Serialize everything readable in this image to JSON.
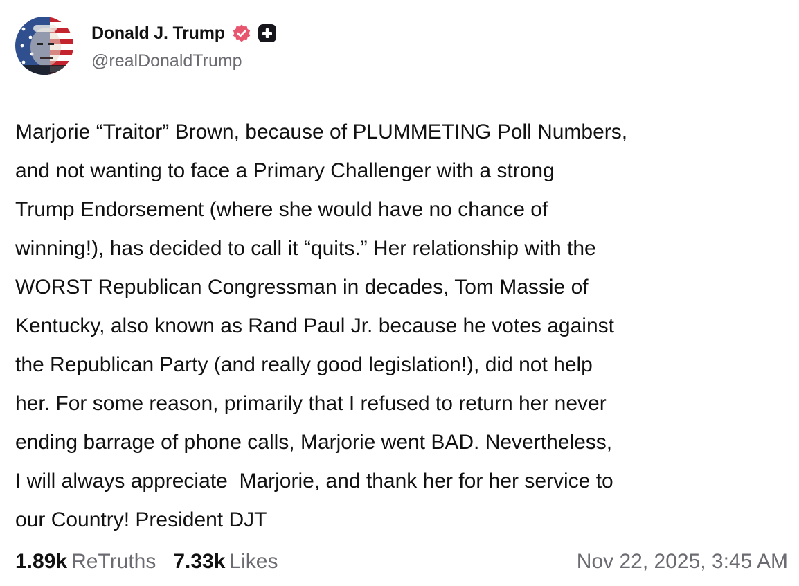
{
  "author": {
    "display_name": "Donald J. Trump",
    "handle": "@realDonaldTrump",
    "verified_icon": "verified-badge-icon",
    "verified_color": "#e8556f",
    "plus_icon": "plus-badge-icon"
  },
  "post": {
    "lines": [
      "Marjorie “Traitor” Brown, because of PLUMMETING Poll Numbers,",
      "and not wanting to face a Primary Challenger with a strong",
      "Trump Endorsement (where she would have no chance of",
      "winning!), has decided to call it “quits.” Her relationship with the",
      "WORST Republican Congressman in decades, Tom Massie of",
      "Kentucky, also known as Rand Paul Jr. because he votes against",
      "the Republican Party (and really good legislation!), did not help",
      "her. For some reason, primarily that I refused to return her never",
      "ending barrage of phone calls, Marjorie went BAD. Nevertheless,",
      "I will always appreciate  Marjorie, and thank her for her service to",
      "our Country! President DJT"
    ]
  },
  "stats": {
    "retruths_count": "1.89k",
    "retruths_label": "ReTruths",
    "likes_count": "7.33k",
    "likes_label": "Likes"
  },
  "timestamp": "Nov 22, 2025, 3:45 AM",
  "colors": {
    "text": "#111111",
    "muted": "#6b6b72",
    "background": "#ffffff"
  }
}
